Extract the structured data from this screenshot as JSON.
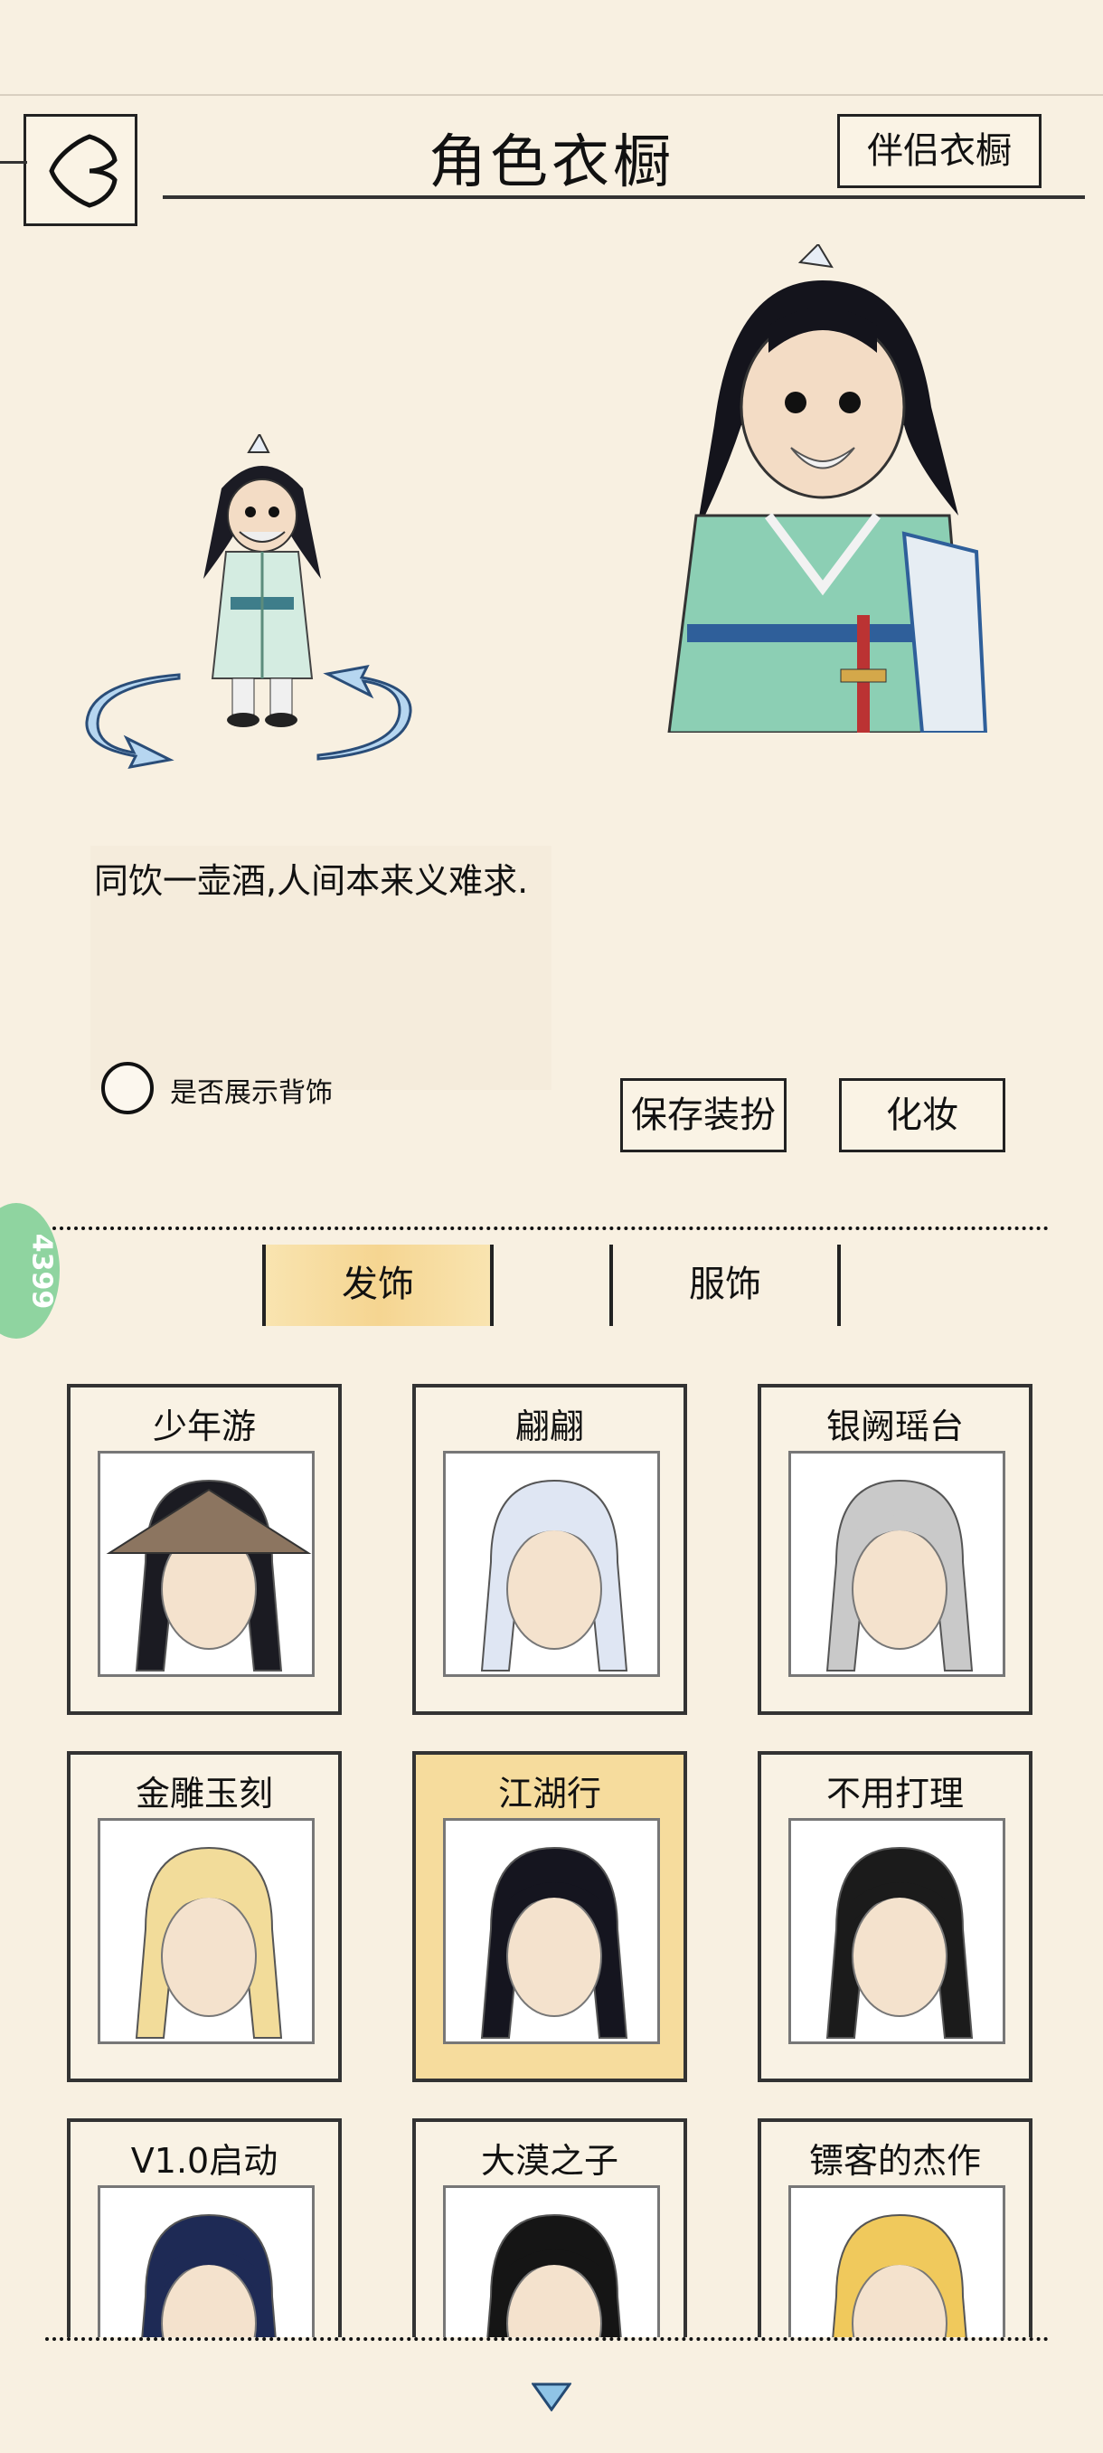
{
  "header": {
    "title": "角色衣橱",
    "partner_button": "伴侣衣橱",
    "back_icon": "back-arrow-icon"
  },
  "character": {
    "quote": "同饮一壶酒,人间本来义难求.",
    "show_back_accessory_label": "是否展示背饰",
    "show_back_accessory_checked": false
  },
  "actions": {
    "save_label": "保存装扮",
    "makeup_label": "化妆"
  },
  "side_badge": "4399",
  "tabs": [
    {
      "label": "发饰",
      "active": true
    },
    {
      "label": "服饰",
      "active": false
    }
  ],
  "hair_items": [
    {
      "name": "少年游",
      "selected": false
    },
    {
      "name": "翩翩",
      "selected": false
    },
    {
      "name": "银阙瑶台",
      "selected": false
    },
    {
      "name": "金雕玉刻",
      "selected": false
    },
    {
      "name": "江湖行",
      "selected": true
    },
    {
      "name": "不用打理",
      "selected": false
    },
    {
      "name": "V1.0启动",
      "selected": false
    },
    {
      "name": "大漠之子",
      "selected": false
    },
    {
      "name": "镖客的杰作",
      "selected": false
    }
  ],
  "colors": {
    "background": "#f8f0e1",
    "selected_card": "#f6dc9d",
    "active_tab": "#f5d591",
    "badge": "#8fd4a0"
  }
}
